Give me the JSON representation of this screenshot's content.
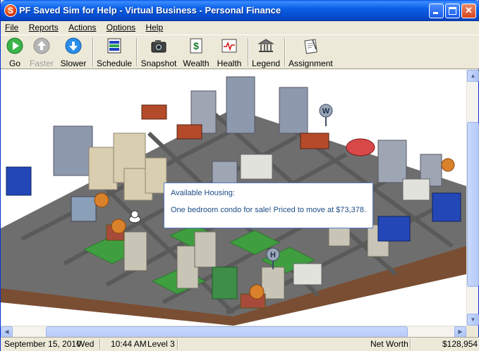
{
  "window": {
    "title": "PF Saved Sim for Help - Virtual Business - Personal Finance",
    "app_icon_letter": "S"
  },
  "menu": [
    {
      "label": "File",
      "accel": "F"
    },
    {
      "label": "Reports",
      "accel": "R"
    },
    {
      "label": "Actions",
      "accel": "A"
    },
    {
      "label": "Options",
      "accel": "O"
    },
    {
      "label": "Help",
      "accel": "H"
    }
  ],
  "toolbar": {
    "go": "Go",
    "faster": "Faster",
    "slower": "Slower",
    "schedule": "Schedule",
    "snapshot": "Snapshot",
    "wealth": "Wealth",
    "health": "Health",
    "legend": "Legend",
    "assignment": "Assignment"
  },
  "map": {
    "marker_w": "W",
    "marker_h": "H"
  },
  "tooltip": {
    "title": "Available Housing:",
    "message": "One bedroom condo for sale! Priced to move at $73,378."
  },
  "status": {
    "date": "September 15, 2010",
    "day": "Wed",
    "time": "10:44 AM",
    "level": "Level 3",
    "net_worth_label": "Net Worth",
    "net_worth_value": "$128,954"
  },
  "colors": {
    "title_bar": "#0a5fe6",
    "ground": "#6b6b6b",
    "grass": "#3f9e3f",
    "dirt": "#8a5a3a",
    "tooltip_text": "#1a4b86"
  }
}
